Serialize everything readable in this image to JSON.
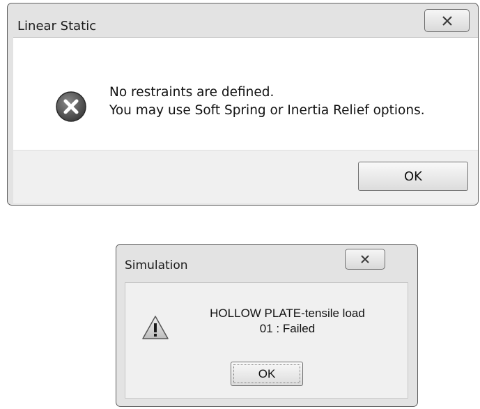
{
  "linear_static_dialog": {
    "title": "Linear Static",
    "icon": "error-icon",
    "message_line1": "No restraints are defined.",
    "message_line2": "You may use Soft Spring or Inertia Relief options.",
    "ok_label": "OK"
  },
  "simulation_dialog": {
    "title": "Simulation",
    "icon": "warning-icon",
    "message_line1": "HOLLOW PLATE-tensile load",
    "message_line2": "01 : Failed",
    "ok_label": "OK"
  },
  "colors": {
    "window_frame": "#e3e3e3",
    "client_bg": "#ffffff",
    "footer_bg": "#f0f0f0",
    "error_icon": "#4a4a4a"
  }
}
